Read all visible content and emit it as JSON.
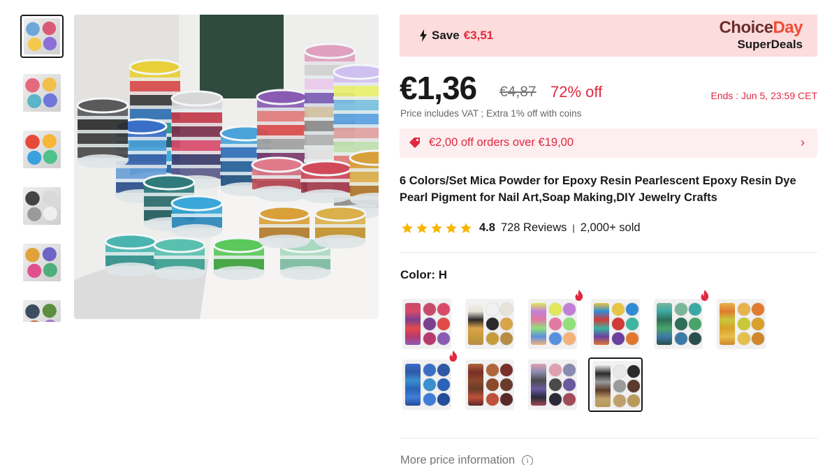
{
  "gallery": {
    "thumbnails": [
      {
        "colors": [
          "#6fa6d8",
          "#d95b76",
          "#f2c94c",
          "#8c6fd6"
        ]
      },
      {
        "colors": [
          "#e66a7e",
          "#f2c04a",
          "#59b5c7",
          "#6f77d8"
        ]
      },
      {
        "colors": [
          "#e84a3a",
          "#f6b637",
          "#3aa0e0",
          "#4fc28b"
        ]
      },
      {
        "colors": [
          "#444444",
          "#d9d9d9",
          "#9a9a9a",
          "#efefef"
        ]
      },
      {
        "colors": [
          "#e1a23c",
          "#6e64c7",
          "#e0508f",
          "#4fae7a"
        ]
      },
      {
        "colors": [
          "#3d4d5e",
          "#5b8f3f",
          "#d66a3c",
          "#9b7ad2"
        ]
      }
    ]
  },
  "deal_banner": {
    "save_label": "Save",
    "save_amount": "€3,51",
    "brand_choice": "Choice",
    "brand_day": "Day",
    "brand_sub": "SuperDeals"
  },
  "pricing": {
    "current": "€1,36",
    "original": "€4,87",
    "discount": "72% off",
    "ends": "Ends :  Jun 5, 23:59 CET",
    "vat_note": "Price includes VAT ; Extra 1% off with coins"
  },
  "coupon": {
    "text": "€2,00 off orders over €19,00",
    "arrow": "›"
  },
  "product": {
    "title": "6 Colors/Set Mica Powder for Epoxy Resin Pearlescent Epoxy Resin Dye Pearl Pigment for Nail Art,Soap Making,DIY Jewelry Crafts",
    "rating": "4.8",
    "stars": 5,
    "reviews": "728 Reviews",
    "separator": "|",
    "sold": "2,000+ sold"
  },
  "color_selector": {
    "label": "Color: H",
    "options": [
      {
        "colors": [
          "#c84a6b",
          "#d94a6a",
          "#7d3f8f",
          "#e24a4a",
          "#b9396f",
          "#8a5bb3"
        ],
        "hot": false,
        "selected": false
      },
      {
        "colors": [
          "#f1f1f1",
          "#e7e3d8",
          "#2a2a2a",
          "#d9a44a",
          "#c79b3a",
          "#b68c45"
        ],
        "hot": false,
        "selected": false
      },
      {
        "colors": [
          "#e0e85a",
          "#c27fd8",
          "#e17aa0",
          "#8fe07a",
          "#5a8fe0",
          "#f2b27a"
        ],
        "hot": true,
        "selected": false
      },
      {
        "colors": [
          "#e7c443",
          "#2f8bd6",
          "#d23a3a",
          "#3db5a0",
          "#6b3fa0",
          "#e0782f"
        ],
        "hot": false,
        "selected": false
      },
      {
        "colors": [
          "#7ab79a",
          "#3aa9a5",
          "#2f6e58",
          "#4aa36b",
          "#3b7aa6",
          "#2a4f4a"
        ],
        "hot": true,
        "selected": false
      },
      {
        "colors": [
          "#e7b24a",
          "#e07a2f",
          "#c8c83a",
          "#d9a02a",
          "#e6c04a",
          "#d0862a"
        ],
        "hot": false,
        "selected": false
      },
      {
        "colors": [
          "#3a6fc8",
          "#2f59a6",
          "#3a8fd0",
          "#2a63b8",
          "#3f7ed8",
          "#244d9a"
        ],
        "hot": true,
        "selected": false
      },
      {
        "colors": [
          "#b0663a",
          "#7a2f2a",
          "#8a4a2a",
          "#6a3a2a",
          "#c0503a",
          "#5a2a2a"
        ],
        "hot": false,
        "selected": false
      },
      {
        "colors": [
          "#e0a0b0",
          "#8a8ab0",
          "#4a4a4a",
          "#6a5aa0",
          "#2a2a3a",
          "#a04a5a"
        ],
        "hot": false,
        "selected": false
      },
      {
        "colors": [
          "#e8e8e8",
          "#2a2a2a",
          "#9a9a9a",
          "#5a3a2a",
          "#c0a06a",
          "#b89a5a"
        ],
        "hot": false,
        "selected": true
      }
    ]
  },
  "more_info": {
    "label": "More price information",
    "icon": "info-icon"
  },
  "accent_colors": {
    "red": "#e0293f",
    "banner_bg": "#fcdcdc",
    "star": "#f7b500"
  }
}
